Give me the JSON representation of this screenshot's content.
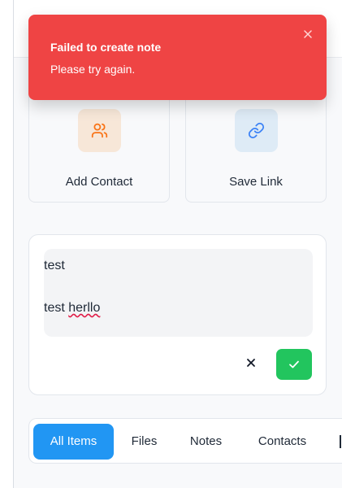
{
  "toast": {
    "title": "Failed to create note",
    "message": "Please try again.",
    "close_icon": "close-icon",
    "color": "#ef4444"
  },
  "quick_actions": [
    {
      "label": "Add Contact",
      "icon": "users-icon",
      "accent": "#f97316",
      "tile_color": "#f7e7d8"
    },
    {
      "label": "Save Link",
      "icon": "link-icon",
      "accent": "#3b82f6",
      "tile_color": "#deebf6"
    }
  ],
  "note_editor": {
    "lines": [
      "test",
      "",
      "test ",
      "herllo"
    ],
    "cancel_icon": "close-icon",
    "confirm_icon": "check-icon",
    "confirm_color": "#22c55e"
  },
  "tabs": {
    "items": [
      "All Items",
      "Files",
      "Notes",
      "Contacts"
    ],
    "active": "All Items",
    "active_color": "#2196f3"
  }
}
